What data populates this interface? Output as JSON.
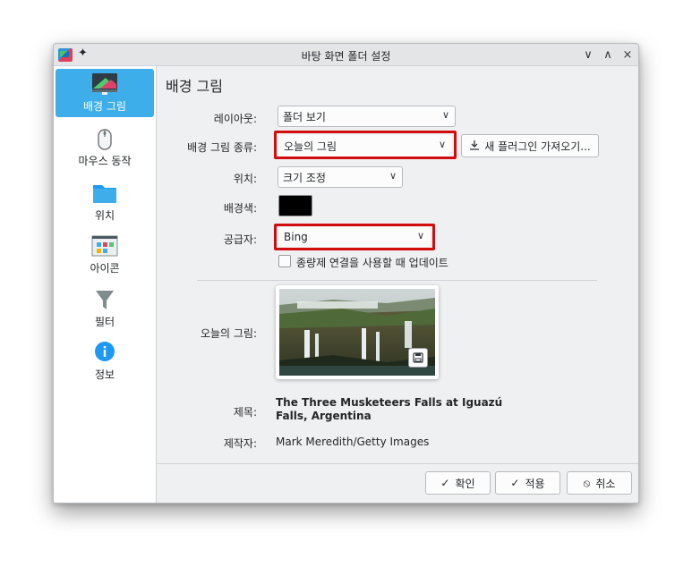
{
  "window": {
    "title": "바탕 화면 폴더 설정",
    "controls": {
      "minimize": "∨",
      "maximize": "∧",
      "close": "×"
    }
  },
  "sidebar": {
    "items": [
      {
        "label": "배경 그림",
        "icon": "wallpaper-icon",
        "active": true
      },
      {
        "label": "마우스 동작",
        "icon": "mouse-icon",
        "active": false
      },
      {
        "label": "위치",
        "icon": "folder-icon",
        "active": false
      },
      {
        "label": "아이콘",
        "icon": "icons-icon",
        "active": false
      },
      {
        "label": "필터",
        "icon": "filter-icon",
        "active": false
      },
      {
        "label": "정보",
        "icon": "info-icon",
        "active": false
      }
    ]
  },
  "main": {
    "heading": "배경 그림",
    "layout": {
      "label": "레이아웃:",
      "value": "폴더 보기"
    },
    "wallpaper_type": {
      "label": "배경 그림 종류:",
      "value": "오늘의 그림"
    },
    "get_plugins_button": "새 플러그인 가져오기...",
    "position": {
      "label": "위치:",
      "value": "크기 조정"
    },
    "background_color": {
      "label": "배경색:",
      "color": "#000000"
    },
    "provider": {
      "label": "공급자:",
      "value": "Bing"
    },
    "metered_checkbox": {
      "label": "종량제 연결을 사용할 때 업데이트",
      "checked": false
    },
    "picture_of_day": {
      "label": "오늘의 그림:"
    },
    "title": {
      "label": "제목:",
      "value": "The Three Musketeers Falls at Iguazú Falls, Argentina"
    },
    "author": {
      "label": "제작자:",
      "value": "Mark Meredith/Getty Images"
    }
  },
  "footer": {
    "ok": "확인",
    "apply": "적용",
    "cancel": "취소"
  },
  "colors": {
    "accent": "#3daee9",
    "highlight_box": "#d10d0d"
  }
}
